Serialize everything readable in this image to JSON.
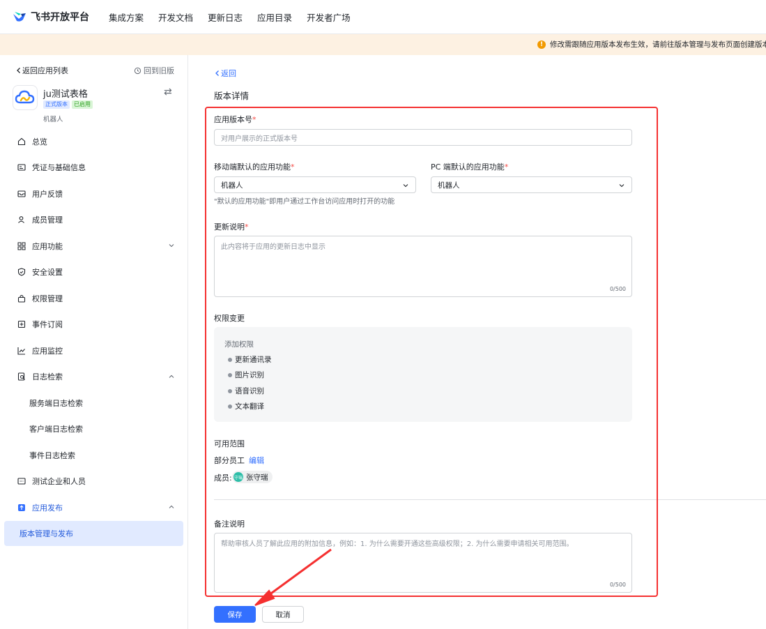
{
  "topnav": {
    "brand": "飞书开放平台",
    "links": [
      "集成方案",
      "开发文档",
      "更新日志",
      "应用目录",
      "开发者广场"
    ]
  },
  "banner": {
    "text": "修改需跟随应用版本发布生效，请前往版本管理与发布页面创建版本"
  },
  "sidebar": {
    "back_label": "返回应用列表",
    "old_version_label": "回到旧版",
    "app": {
      "name": "ju测试表格",
      "tag_release": "正式版本",
      "tag_enabled": "已启用",
      "type": "机器人"
    },
    "items": [
      {
        "label": "总览"
      },
      {
        "label": "凭证与基础信息"
      },
      {
        "label": "用户反馈"
      },
      {
        "label": "成员管理"
      },
      {
        "label": "应用功能"
      },
      {
        "label": "安全设置"
      },
      {
        "label": "权限管理"
      },
      {
        "label": "事件订阅"
      },
      {
        "label": "应用监控"
      },
      {
        "label": "日志检索"
      },
      {
        "label": "服务端日志检索"
      },
      {
        "label": "客户端日志检索"
      },
      {
        "label": "事件日志检索"
      },
      {
        "label": "测试企业和人员"
      },
      {
        "label": "应用发布"
      },
      {
        "label": "版本管理与发布"
      }
    ]
  },
  "main": {
    "back_label": "返回",
    "page_title": "版本详情",
    "version_label": "应用版本号",
    "version_placeholder": "对用户展示的正式版本号",
    "mobile_label": "移动端默认的应用功能",
    "mobile_value": "机器人",
    "pc_label": "PC 端默认的应用功能",
    "pc_value": "机器人",
    "default_hint": "\"默认的应用功能\"即用户通过工作台访问应用时打开的功能",
    "changelog_label": "更新说明",
    "changelog_placeholder": "此内容将于应用的更新日志中显示",
    "changelog_counter": "0/500",
    "perm_label": "权限变更",
    "perm_add_title": "添加权限",
    "perm_items": [
      "更新通讯录",
      "图片识别",
      "语音识别",
      "文本翻译"
    ],
    "scope_label": "可用范围",
    "scope_value": "部分员工",
    "scope_edit": "编辑",
    "member_prefix": "成员:",
    "member_avatar_text": "守瑞",
    "member_name": "张守瑞",
    "remark_label": "备注说明",
    "remark_placeholder": "帮助审核人员了解此应用的附加信息，例如：1. 为什么需要开通这些高级权限；2. 为什么需要申请相关可用范围。",
    "remark_counter": "0/500",
    "save_label": "保存",
    "cancel_label": "取消"
  },
  "colors": {
    "primary": "#3370ff",
    "highlight_box": "#f53030",
    "banner_bg": "#fdf1e2",
    "warning": "#f29a00"
  }
}
